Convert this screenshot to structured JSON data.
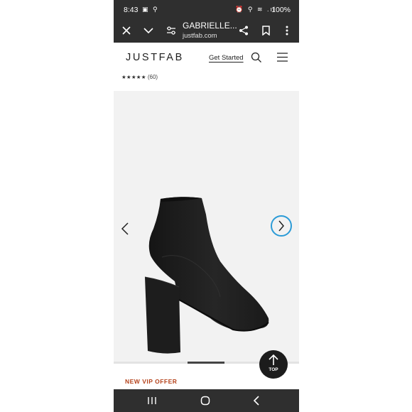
{
  "status_bar": {
    "time": "8:43",
    "left_icons": "▣ ⚲",
    "right_icons": "⏰ ⚲ ≋ .ıl",
    "battery": "100%"
  },
  "browser": {
    "tab_title": "GABRIELLE...",
    "url": "justfab.com"
  },
  "site": {
    "logo": "JUSTFAB",
    "get_started": "Get Started"
  },
  "product": {
    "stars": "★★★★★",
    "review_count": "(60)",
    "gallery_progress": 0.2
  },
  "top_button": {
    "label": "TOP"
  },
  "promo": {
    "vip_offer": "NEW VIP OFFER"
  },
  "colors": {
    "chrome_bg": "#2f2f2f",
    "gallery_bg": "#f2f2f2",
    "next_arrow_ring": "#2b9bd7",
    "vip_offer_text": "#b5431c"
  },
  "icons": {
    "close": "close-icon",
    "collapse": "chevron-down-icon",
    "site_settings": "tune-icon",
    "share": "share-icon",
    "bookmark": "bookmark-icon",
    "more": "more-vertical-icon",
    "search": "search-icon",
    "menu": "hamburger-menu-icon",
    "prev": "chevron-left-icon",
    "next": "chevron-right-icon",
    "top": "arrow-up-icon",
    "recents": "recents-icon",
    "home": "home-icon",
    "back": "back-icon"
  }
}
